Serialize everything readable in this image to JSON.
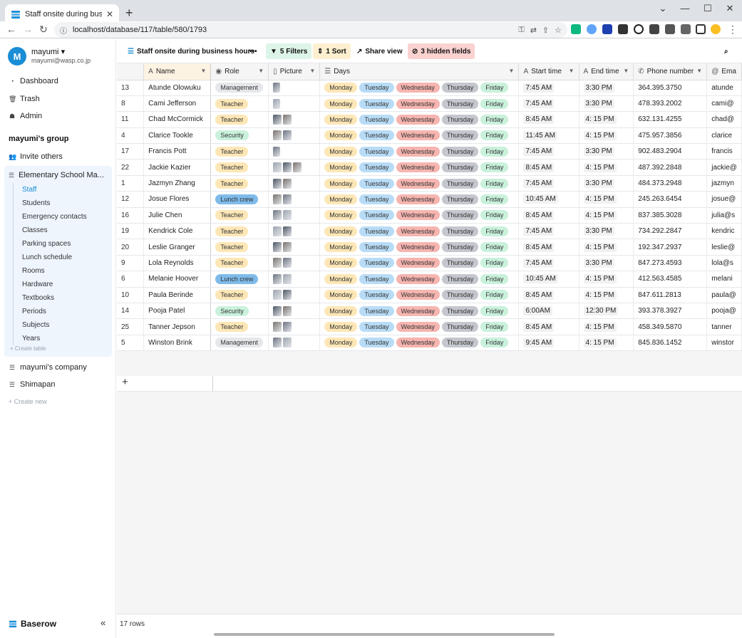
{
  "browser": {
    "tab_title": "Staff onsite during business hours",
    "url": "localhost/database/117/table/580/1793"
  },
  "user": {
    "initial": "M",
    "name": "mayumi",
    "email": "mayumi@wasp.co.jp"
  },
  "sidebar": {
    "nav": [
      "Dashboard",
      "Trash",
      "Admin"
    ],
    "group_title": "mayumi's group",
    "invite": "Invite others",
    "database": "Elementary School Ma...",
    "tables": [
      "Staff",
      "Students",
      "Emergency contacts",
      "Classes",
      "Parking spaces",
      "Lunch schedule",
      "Rooms",
      "Hardware",
      "Textbooks",
      "Periods",
      "Subjects",
      "Years"
    ],
    "create_table": "+ Create table",
    "other_dbs": [
      "mayumi's company",
      "Shimapan"
    ],
    "create_new": "+ Create new",
    "brand": "Baserow",
    "collapse": "«"
  },
  "viewbar": {
    "view_name": "Staff onsite during business hours",
    "more": "•••",
    "filters": "5 Filters",
    "sort": "1 Sort",
    "share": "Share view",
    "hidden": "3 hidden fields"
  },
  "columns": [
    "Name",
    "Role",
    "Picture",
    "Days",
    "Start time",
    "End time",
    "Phone number",
    "Ema"
  ],
  "days": [
    "Monday",
    "Tuesday",
    "Wednesday",
    "Thursday",
    "Friday"
  ],
  "colors": {
    "Management": "#e5e7eb",
    "Teacher": "#fde7b7",
    "Security": "#c9f1dc",
    "Lunch crew": "#7fbbea",
    "Monday": "#fde7b7",
    "Tuesday": "#b8dcf6",
    "Wednesday": "#f6b5b0",
    "Thursday": "#c4c7cd",
    "Friday": "#c9f1dc"
  },
  "rows": [
    {
      "id": "13",
      "name": "Atunde Olowuku",
      "role": "Management",
      "pics": 1,
      "start": "7:45 AM",
      "end": "3:30 PM",
      "phone": "364.395.3750",
      "email": "atunde"
    },
    {
      "id": "8",
      "name": "Cami Jefferson",
      "role": "Teacher",
      "pics": 1,
      "start": "7:45 AM",
      "end": "3:30 PM",
      "phone": "478.393.2002",
      "email": "cami@"
    },
    {
      "id": "11",
      "name": "Chad McCormick",
      "role": "Teacher",
      "pics": 2,
      "start": "8:45 AM",
      "end": "4: 15 PM",
      "phone": "632.131.4255",
      "email": "chad@"
    },
    {
      "id": "4",
      "name": "Clarice Tookle",
      "role": "Security",
      "pics": 2,
      "start": "11:45 AM",
      "end": "4: 15 PM",
      "phone": "475.957.3856",
      "email": "clarice"
    },
    {
      "id": "17",
      "name": "Francis Pott",
      "role": "Teacher",
      "pics": 1,
      "start": "7:45 AM",
      "end": "3:30 PM",
      "phone": "902.483.2904",
      "email": "francis"
    },
    {
      "id": "22",
      "name": "Jackie Kazier",
      "role": "Teacher",
      "pics": 3,
      "start": "8:45 AM",
      "end": "4: 15 PM",
      "phone": "487.392.2848",
      "email": "jackie@"
    },
    {
      "id": "1",
      "name": "Jazmyn Zhang",
      "role": "Teacher",
      "pics": 2,
      "start": "7:45 AM",
      "end": "3:30 PM",
      "phone": "484.373.2948",
      "email": "jazmyn"
    },
    {
      "id": "12",
      "name": "Josue Flores",
      "role": "Lunch crew",
      "pics": 2,
      "start": "10:45 AM",
      "end": "4: 15 PM",
      "phone": "245.263.6454",
      "email": "josue@"
    },
    {
      "id": "16",
      "name": "Julie Chen",
      "role": "Teacher",
      "pics": 2,
      "start": "8:45 AM",
      "end": "4: 15 PM",
      "phone": "837.385.3028",
      "email": "julia@s"
    },
    {
      "id": "19",
      "name": "Kendrick Cole",
      "role": "Teacher",
      "pics": 2,
      "start": "7:45 AM",
      "end": "3:30 PM",
      "phone": "734.292.2847",
      "email": "kendric"
    },
    {
      "id": "20",
      "name": "Leslie Granger",
      "role": "Teacher",
      "pics": 2,
      "start": "8:45 AM",
      "end": "4: 15 PM",
      "phone": "192.347.2937",
      "email": "leslie@"
    },
    {
      "id": "9",
      "name": "Lola Reynolds",
      "role": "Teacher",
      "pics": 2,
      "start": "7:45 AM",
      "end": "3:30 PM",
      "phone": "847.273.4593",
      "email": "lola@s"
    },
    {
      "id": "6",
      "name": "Melanie Hoover",
      "role": "Lunch crew",
      "pics": 2,
      "start": "10:45 AM",
      "end": "4: 15 PM",
      "phone": "412.563.4585",
      "email": "melani"
    },
    {
      "id": "10",
      "name": "Paula Berinde",
      "role": "Teacher",
      "pics": 2,
      "start": "8:45 AM",
      "end": "4: 15 PM",
      "phone": "847.611.2813",
      "email": "paula@"
    },
    {
      "id": "14",
      "name": "Pooja Patel",
      "role": "Security",
      "pics": 2,
      "start": "6:00AM",
      "end": "12:30 PM",
      "phone": "393.378.3927",
      "email": "pooja@"
    },
    {
      "id": "25",
      "name": "Tanner Jepson",
      "role": "Teacher",
      "pics": 2,
      "start": "8:45 AM",
      "end": "4: 15 PM",
      "phone": "458.349.5870",
      "email": "tanner"
    },
    {
      "id": "5",
      "name": "Winston Brink",
      "role": "Management",
      "pics": 2,
      "start": "9:45 AM",
      "end": "4: 15 PM",
      "phone": "845.836.1452",
      "email": "winstor"
    }
  ],
  "footer": {
    "row_count": "17 rows",
    "add": "+"
  }
}
